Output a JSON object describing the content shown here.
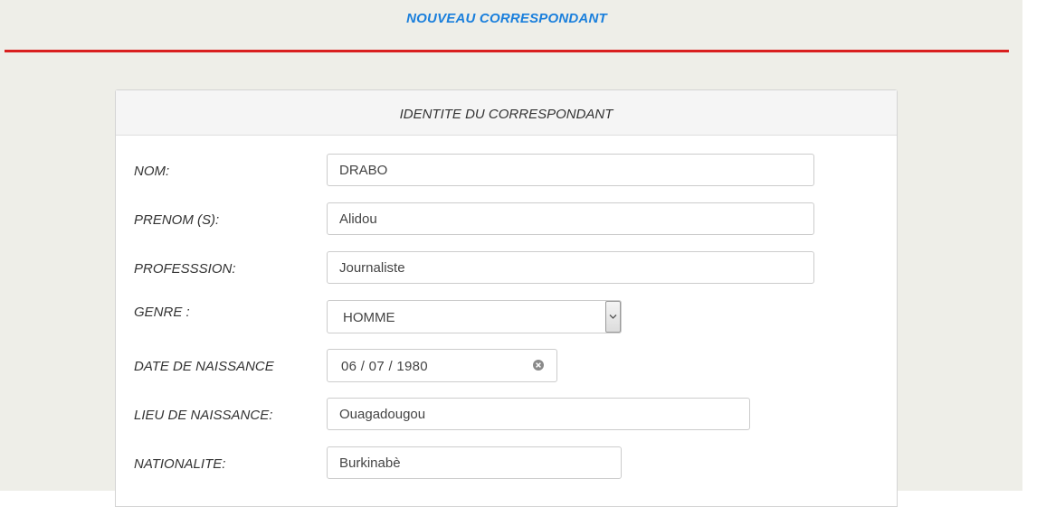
{
  "header": {
    "title": "NOUVEAU CORRESPONDANT",
    "rule_color": "#d9201f",
    "title_color": "#1a7fdc"
  },
  "panel": {
    "heading": "IDENTITE DU CORRESPONDANT",
    "fields": {
      "nom": {
        "label": "NOM:",
        "value": "DRABO"
      },
      "prenom": {
        "label": "PRENOM (S):",
        "value": "Alidou"
      },
      "profession": {
        "label": "PROFESSSION:",
        "value": "Journaliste"
      },
      "genre": {
        "label": "GENRE :",
        "value": "HOMME",
        "icon": "chevron-down-icon"
      },
      "date_naissance": {
        "label": "DATE DE NAISSANCE",
        "value": "06 / 07 / 1980",
        "icon": "clear-icon"
      },
      "lieu_naissance": {
        "label": "LIEU DE NAISSANCE:",
        "value": "Ouagadougou"
      },
      "nationalite": {
        "label": "NATIONALITE:",
        "value": "Burkinabè"
      }
    }
  }
}
